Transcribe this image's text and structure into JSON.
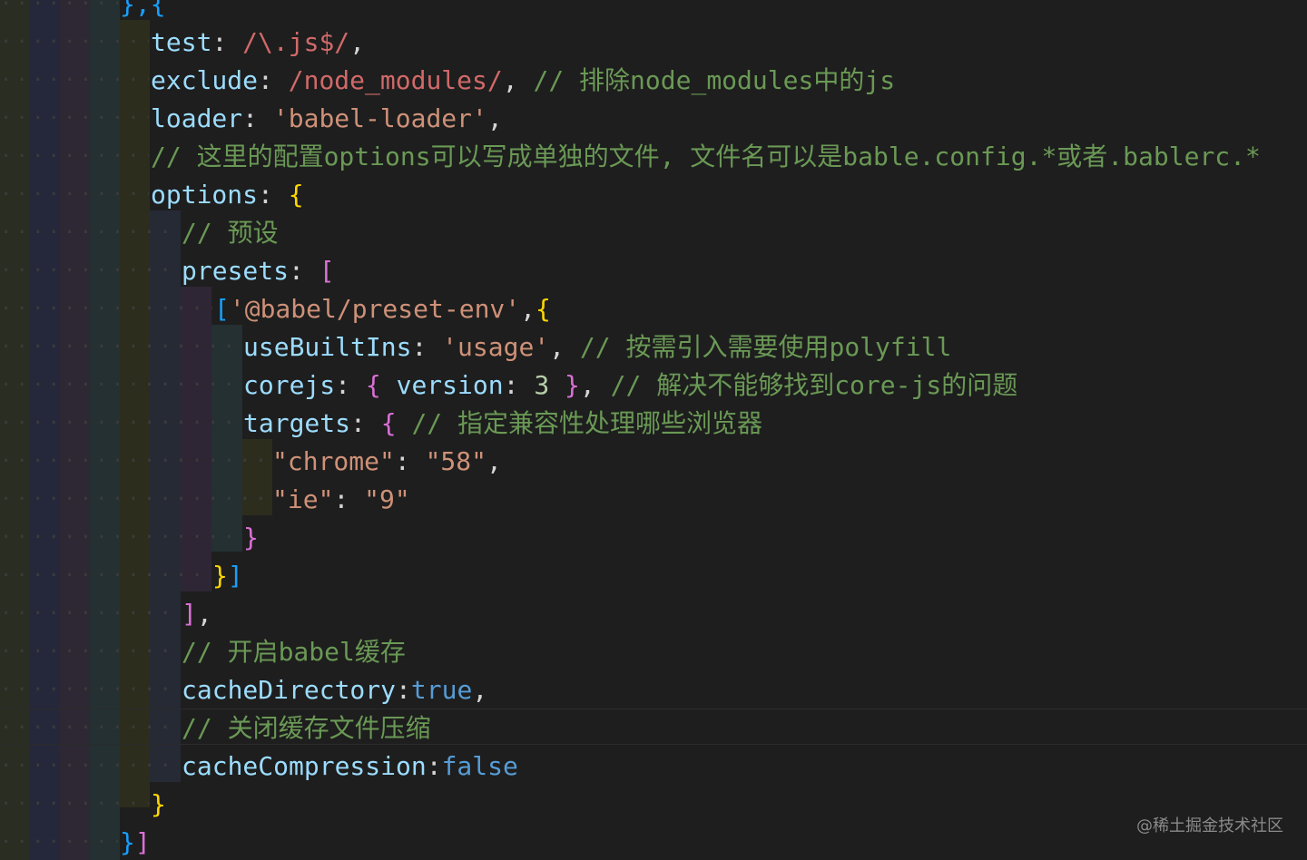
{
  "colors": {
    "background": "#1e1e1e",
    "identifier": "#9cdcfe",
    "string": "#ce9178",
    "regex": "#d16969",
    "number": "#b5cea8",
    "keyword": "#569cd6",
    "comment": "#6a9955",
    "bracket_gold": "#ffd700",
    "bracket_purple": "#da70d6",
    "bracket_blue": "#179fff"
  },
  "lines": [
    {
      "tokens": [
        {
          "t": "},{",
          "c": "b3"
        }
      ]
    },
    {
      "tokens": [
        {
          "t": "test",
          "c": "prop"
        },
        {
          "t": ": ",
          "c": "punc"
        },
        {
          "t": "/\\.js$/",
          "c": "regex"
        },
        {
          "t": ",",
          "c": "punc"
        }
      ]
    },
    {
      "tokens": [
        {
          "t": "exclude",
          "c": "prop"
        },
        {
          "t": ": ",
          "c": "punc"
        },
        {
          "t": "/node_modules/",
          "c": "regex"
        },
        {
          "t": ", ",
          "c": "punc"
        },
        {
          "t": "// 排除node_modules中的js",
          "c": "com"
        }
      ]
    },
    {
      "tokens": [
        {
          "t": "loader",
          "c": "prop"
        },
        {
          "t": ": ",
          "c": "punc"
        },
        {
          "t": "'babel-loader'",
          "c": "str"
        },
        {
          "t": ",",
          "c": "punc"
        }
      ]
    },
    {
      "tokens": [
        {
          "t": "// 这里的配置options可以写成单独的文件, 文件名可以是bable.config.*或者.bablerc.*",
          "c": "com"
        }
      ]
    },
    {
      "tokens": [
        {
          "t": "options",
          "c": "prop"
        },
        {
          "t": ": ",
          "c": "punc"
        },
        {
          "t": "{",
          "c": "b1"
        }
      ]
    },
    {
      "tokens": [
        {
          "t": "// 预设",
          "c": "com"
        }
      ]
    },
    {
      "tokens": [
        {
          "t": "presets",
          "c": "prop"
        },
        {
          "t": ": ",
          "c": "punc"
        },
        {
          "t": "[",
          "c": "b2"
        }
      ]
    },
    {
      "tokens": [
        {
          "t": "[",
          "c": "b3"
        },
        {
          "t": "'@babel/preset-env'",
          "c": "str"
        },
        {
          "t": ",",
          "c": "punc"
        },
        {
          "t": "{",
          "c": "b1"
        }
      ]
    },
    {
      "tokens": [
        {
          "t": "useBuiltIns",
          "c": "prop"
        },
        {
          "t": ": ",
          "c": "punc"
        },
        {
          "t": "'usage'",
          "c": "str"
        },
        {
          "t": ", ",
          "c": "punc"
        },
        {
          "t": "// 按需引入需要使用polyfill",
          "c": "com"
        }
      ]
    },
    {
      "tokens": [
        {
          "t": "corejs",
          "c": "prop"
        },
        {
          "t": ": ",
          "c": "punc"
        },
        {
          "t": "{",
          "c": "b2"
        },
        {
          "t": " ",
          "c": "punc"
        },
        {
          "t": "version",
          "c": "prop"
        },
        {
          "t": ": ",
          "c": "punc"
        },
        {
          "t": "3",
          "c": "num"
        },
        {
          "t": " ",
          "c": "punc"
        },
        {
          "t": "}",
          "c": "b2"
        },
        {
          "t": ", ",
          "c": "punc"
        },
        {
          "t": "// 解决不能够找到core-js的问题",
          "c": "com"
        }
      ]
    },
    {
      "tokens": [
        {
          "t": "targets",
          "c": "prop"
        },
        {
          "t": ": ",
          "c": "punc"
        },
        {
          "t": "{",
          "c": "b2"
        },
        {
          "t": " ",
          "c": "punc"
        },
        {
          "t": "// 指定兼容性处理哪些浏览器",
          "c": "com"
        }
      ]
    },
    {
      "tokens": [
        {
          "t": "\"chrome\"",
          "c": "str"
        },
        {
          "t": ": ",
          "c": "punc"
        },
        {
          "t": "\"58\"",
          "c": "str"
        },
        {
          "t": ",",
          "c": "punc"
        }
      ]
    },
    {
      "tokens": [
        {
          "t": "\"ie\"",
          "c": "str"
        },
        {
          "t": ": ",
          "c": "punc"
        },
        {
          "t": "\"9\"",
          "c": "str"
        }
      ]
    },
    {
      "tokens": [
        {
          "t": "}",
          "c": "b2"
        }
      ]
    },
    {
      "tokens": [
        {
          "t": "}",
          "c": "b1"
        },
        {
          "t": "]",
          "c": "b3"
        }
      ]
    },
    {
      "tokens": [
        {
          "t": "]",
          "c": "b2"
        },
        {
          "t": ",",
          "c": "punc"
        }
      ]
    },
    {
      "tokens": [
        {
          "t": "// 开启babel缓存",
          "c": "com"
        }
      ]
    },
    {
      "tokens": [
        {
          "t": "cacheDirectory",
          "c": "prop"
        },
        {
          "t": ":",
          "c": "punc"
        },
        {
          "t": "true",
          "c": "kw"
        },
        {
          "t": ",",
          "c": "punc"
        }
      ]
    },
    {
      "tokens": [
        {
          "t": "// 关闭缓存文件压缩",
          "c": "com"
        }
      ]
    },
    {
      "tokens": [
        {
          "t": "cacheCompression",
          "c": "prop"
        },
        {
          "t": ":",
          "c": "punc"
        },
        {
          "t": "false",
          "c": "kw"
        }
      ]
    },
    {
      "tokens": [
        {
          "t": "}",
          "c": "b1"
        }
      ]
    },
    {
      "tokens": [
        {
          "t": "}",
          "c": "b3"
        },
        {
          "t": "]",
          "c": "b2"
        }
      ]
    }
  ],
  "watermark": "@稀土掘金技术社区"
}
